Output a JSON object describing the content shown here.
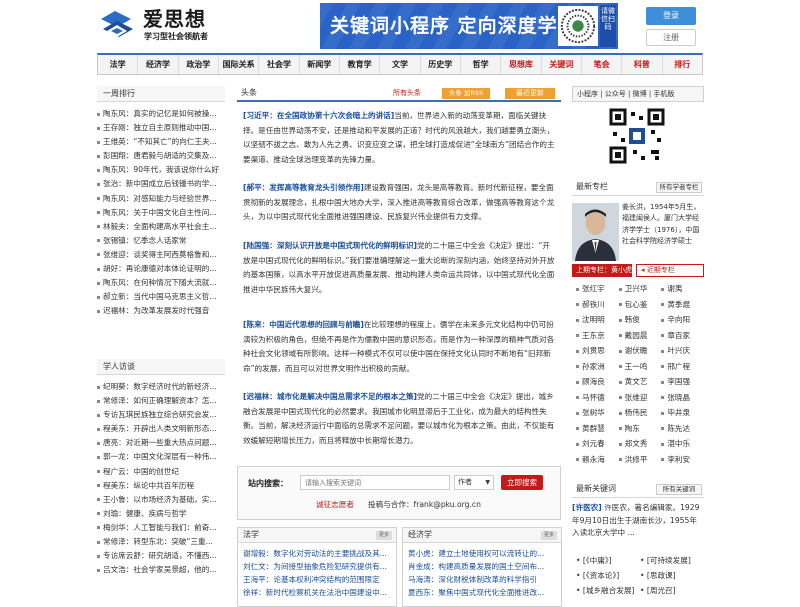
{
  "header": {
    "logo_name": "爱思想",
    "logo_sub": "学习型社会领航者",
    "banner_text": "关键词小程序 定向深度学习",
    "banner_side": "请微信扫码",
    "login": "登录",
    "register": "注册"
  },
  "nav": {
    "items": [
      {
        "label": "法学",
        "red": false
      },
      {
        "label": "经济学",
        "red": false
      },
      {
        "label": "政治学",
        "red": false
      },
      {
        "label": "国际关系",
        "red": false
      },
      {
        "label": "社会学",
        "red": false
      },
      {
        "label": "新闻学",
        "red": false
      },
      {
        "label": "教育学",
        "red": false
      },
      {
        "label": "文学",
        "red": false
      },
      {
        "label": "历史学",
        "red": false
      },
      {
        "label": "哲学",
        "red": false
      },
      {
        "label": "思想库",
        "red": true
      },
      {
        "label": "关键词",
        "red": true
      },
      {
        "label": "笔会",
        "red": true
      },
      {
        "label": "科普",
        "red": true
      },
      {
        "label": "排行",
        "red": true
      }
    ]
  },
  "ranking": {
    "title": "一周排行",
    "items": [
      "陶东风：真实的记忆是如何被操...",
      "王存刚：独立自主原则推动中国...",
      "王维英：“不知其亡”的向仁王夫...",
      "彭国翔：唐君毅与胡适的交集及...",
      "陶东风：90年代，我该说你什么好",
      "张治：新中国成立后钱锺书的学...",
      "陶东风：对感知能力与经验世界...",
      "陶东风：关于中国文化自主性问...",
      "林毅夫：全面构建高水平社会主...",
      "张锡镇：忆季念人话家常",
      "张维迎：谈奖得主阿西莫格鲁和...",
      "胡好：再论康德对本体论证明的...",
      "陶东风：在何种情况下随大流就...",
      "郝立新：当代中国马克思主义哲...",
      "迟福林：为改革发展发时代强音"
    ]
  },
  "scholars": {
    "title": "学人访谈",
    "items": [
      "纪明葵：数字经济时代的新经济...",
      "常修泽：如何正确理解资本？怎...",
      "专访瓦琪民族独立综合研究会发...",
      "程美东：开辟出人类文明新形态...",
      "唐亮：对近期一些重大热点问题...",
      "郭一龙：中国文化深层有一种伟...",
      "程广云：中国的创世纪",
      "程美东：纵论中共百年历程",
      "王小鲁：以市场经济为基础，实...",
      "刘瑜：健康、疾病与哲学",
      "梅剑华：人工智能与我们：前奇...",
      "常修泽：转型东北：突破“三重...",
      "专访席云舒：研究胡适，不懂西...",
      "吕文浩：社会学家吴景超，他的..."
    ]
  },
  "headlines": {
    "title": "头条",
    "more": "所有头条",
    "rss": "头条 加RSS",
    "latest": "最近更新",
    "articles": [
      {
        "title": "习近平：在全国政协第十六次会暗上的讲话",
        "body": "当前，世界进入新的动荡变革期，面临关键抉择。是任由世界动荡不安，还是推动和平发展的正道？时代的风浪越大，我们越要勇立潮头，以坚韧不拔之志、敢为人先之勇、识变应变之谋，把全球打造成促进“全球南方”团结合作的主要渠道、推动全球治理变革的先锋力量。"
      },
      {
        "title": "郝平：发挥高等教育龙头引领作用",
        "body": "建设教育强国，龙头是高等教育。新时代新征程，要全面贯彻新的发展理念，扎根中国大地办大学，深入推进高等教育综合改革，做强高等教育这个龙头，为以中国式现代化全面推进强国建设、民族复兴伟业提供有力支撑。"
      },
      {
        "title": "陆国强：深刻认识开放是中国式现代化的鲜明标识",
        "body": "党的二十届三中全会《决定》提出：“开放是中国式现代化的鲜明标识。”我们要准确理解这一重大论断的深刻内涵，始终坚持对外开放的基本国策，以高水平开放促进高质量发展、推动构建人类命运共同体，以中国式现代化全面推进中华民族伟大复兴。"
      },
      {
        "title": "陈来：中国近代思想的回顾与前瞻",
        "body": "在比较理想的程度上，儒学在未来多元文化结构中仍可扮演较为积极的角色，但绝不再是作为儒教中国的意识形态，而是作为一种深厚的精神气质对各种社会文化领域有所影响。这样一种模式不仅可以使中国在保持文化认同时不断地有“旧邦新命”的发展，而且可以对世界文明作出积极的贡献。"
      },
      {
        "title": "迟福林：城市化是解决中国总需求不足的根本之策",
        "body": "党的二十届三中全会《决定》提出，城乡融合发展是中国式现代化的必然要求。我国城市化明显滞后于工业化，成为最大的结构性失衡。当前，解决经济运行中面临的总需求不足问题，要以城市化为根本之策。由此，不仅能有效缓解短期增长压力，而且将释放中长期增长潜力。"
      }
    ]
  },
  "search": {
    "label": "站内搜索：",
    "placeholder": "请输入搜索关键词",
    "author_option": "作者",
    "button": "立即搜索",
    "recruit": "诚征志愿者",
    "contact": "投稿与合作：frank@pku.org.cn"
  },
  "law_column": {
    "title": "法学",
    "more": "更多",
    "items": [
      "谢增毅：数字化对劳动法的主要挑战及其...",
      "刘仁文：为间接型抽象危险犯研究提供有...",
      "王海平：论基本权利冲突结构的范围限定",
      "徐祥：新时代检察机关在法治中国建设中..."
    ]
  },
  "econ_column": {
    "title": "经济学",
    "more": "更多",
    "items": [
      "黄小虎：建立土地使用权可以流转让的...",
      "肖金成：构建高质量发展的国土空间布...",
      "马海涛：深化财税体制改革的科学指引",
      "夏西东：聚焦中国式现代化全面推进改..."
    ]
  },
  "right": {
    "links": "小程序 | 公众号 | 微博 | 手机版",
    "expert_title": "最新专栏",
    "expert_all": "所有学者专栏",
    "expert_bio": "姜长洪，1954年5月生，福建闽侯人。厦门大学经济学学士（1976），中国社会科学院经济学硕士",
    "prev_issue": "上期专栏：黄小虎",
    "next_issue": "近期专栏",
    "expert_names": [
      "张红宇",
      "卫兴华",
      "谢夷",
      "郝铁川",
      "包心鉴",
      "黄季焜",
      "沈明明",
      "韩俊",
      "辛向阳",
      "王东京",
      "戴园晨",
      "章百家",
      "刘贯思",
      "谢伏瞻",
      "叶兴庆",
      "孙家洲",
      "王一鸣",
      "邢广程",
      "顾海良",
      "黄文艺",
      "李国强",
      "马怀德",
      "张维迎",
      "张晓晶",
      "张树华",
      "杨伟民",
      "毕井泉",
      "黄群慧",
      "陶东",
      "陈先达",
      "刘元春",
      "郑文秀",
      "湛中乐",
      "赖永海",
      "洪修平",
      "李利安"
    ],
    "kw_title": "最新关键词",
    "kw_all": "所有关键词",
    "kw_term": "[许医农]",
    "kw_desc": "许医农，著名编辑家。1929年9月10日出生于湖南长沙，1955年入读北京大学中 ...",
    "kw_items": [
      "[《中庸》]",
      "[可持续发展]",
      "[《资本论》]",
      "[思政课]",
      "[城乡融合发展]",
      "[周光召]"
    ]
  }
}
